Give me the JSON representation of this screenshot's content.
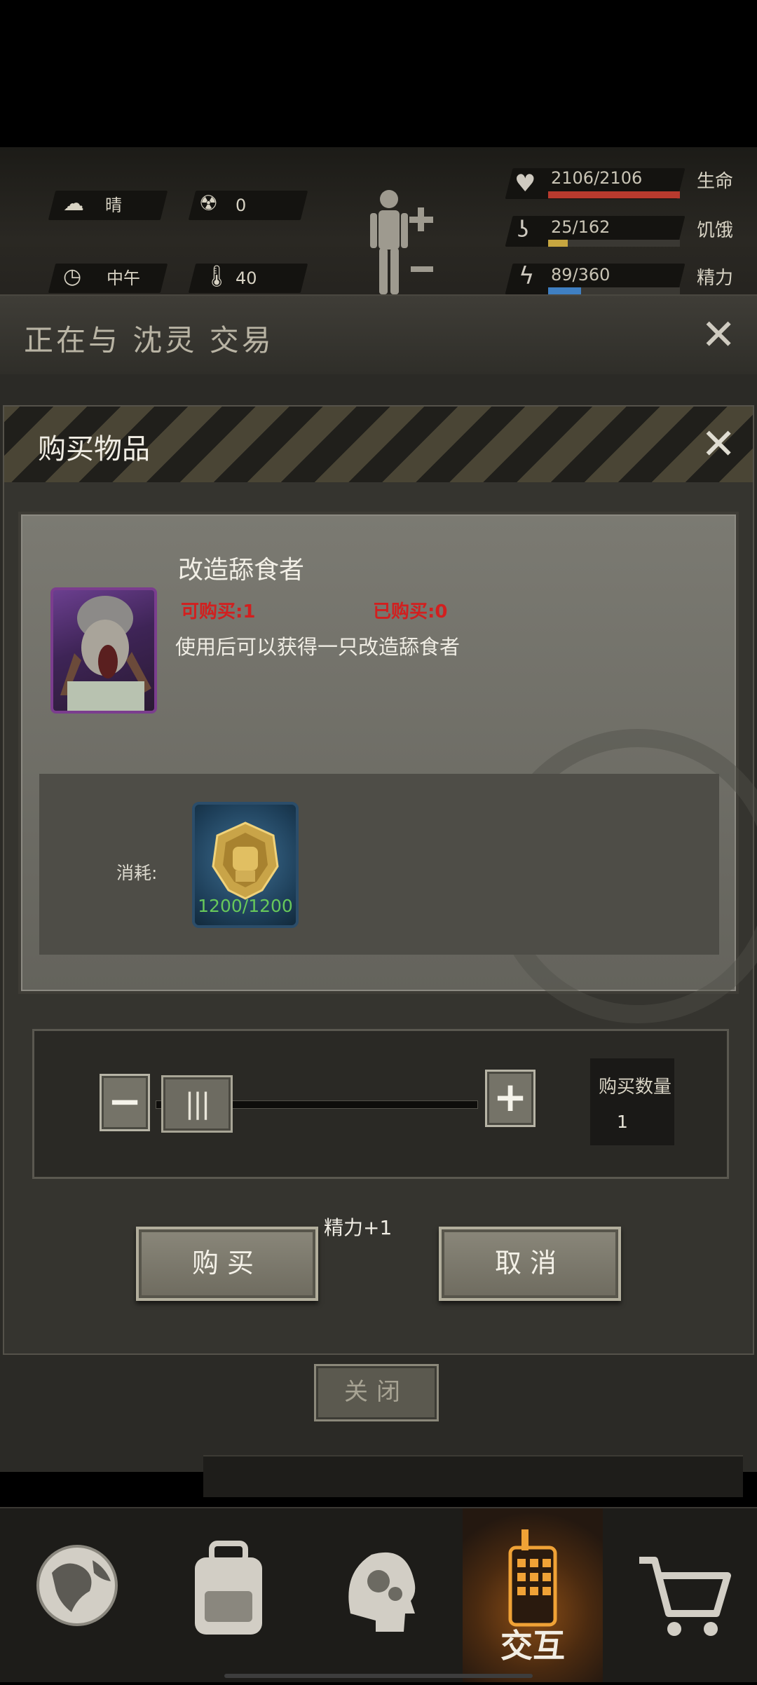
{
  "hud": {
    "weather": "晴",
    "radiation": "0",
    "time_of_day": "中午",
    "temperature": "40",
    "stats": [
      {
        "value": "2106/2106",
        "label": "生命",
        "fill": 1.0,
        "color": "#b83a2e",
        "icon": "heart-pulse-icon"
      },
      {
        "value": "25/162",
        "label": "饥饿",
        "fill": 0.15,
        "color": "#c7a640",
        "icon": "stomach-icon"
      },
      {
        "value": "89/360",
        "label": "精力",
        "fill": 0.25,
        "color": "#3f7fc2",
        "icon": "lightning-icon"
      }
    ]
  },
  "trade": {
    "title": "正在与 沈灵 交易"
  },
  "dialog": {
    "title": "购买物品",
    "item": {
      "name": "改造舔食者",
      "can_buy": "可购买:1",
      "bought": "已购买:0",
      "description": "使用后可以获得一只改造舔食者"
    },
    "cost_label": "消耗:",
    "cost_amount": "1200/1200",
    "quantity_label": "购买数量",
    "quantity_value": "1",
    "slider_fill": 0.0,
    "energy_note": "精力+1",
    "buy_label": "购买",
    "cancel_label": "取消"
  },
  "close_label": "关闭",
  "nav": {
    "active_label": "交互",
    "items": [
      "globe-icon",
      "backpack-icon",
      "brain-head-icon",
      "radio-icon",
      "cart-icon"
    ]
  }
}
